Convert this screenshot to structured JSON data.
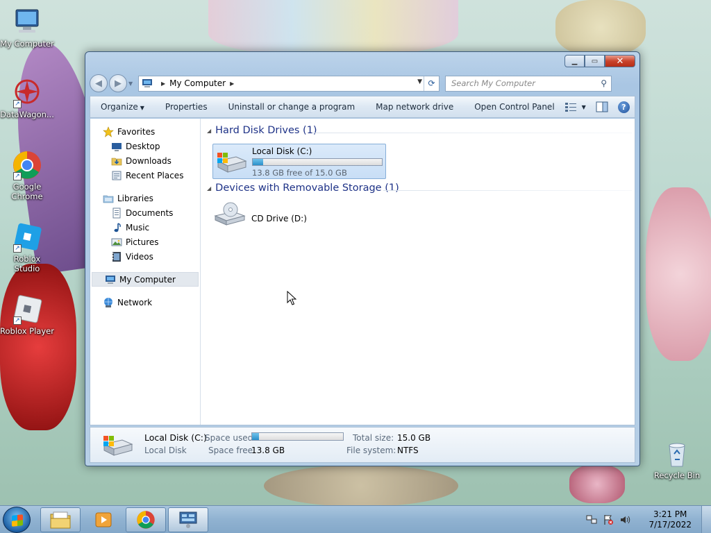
{
  "desktop": {
    "icons": [
      {
        "label": "My Computer"
      },
      {
        "label": "DataWagon..."
      },
      {
        "label": "Google Chrome"
      },
      {
        "label": "Roblox Studio"
      },
      {
        "label": "Roblox Player"
      },
      {
        "label": "Recycle Bin"
      }
    ]
  },
  "window": {
    "address": {
      "crumb": "My Computer"
    },
    "search": {
      "placeholder": "Search My Computer"
    },
    "toolbar": {
      "organize": "Organize",
      "properties": "Properties",
      "uninstall": "Uninstall or change a program",
      "map_drive": "Map network drive",
      "control_panel": "Open Control Panel"
    },
    "nav": {
      "favorites": "Favorites",
      "desktop": "Desktop",
      "downloads": "Downloads",
      "recent": "Recent Places",
      "libraries": "Libraries",
      "documents": "Documents",
      "music": "Music",
      "pictures": "Pictures",
      "videos": "Videos",
      "my_computer": "My Computer",
      "network": "Network"
    },
    "sections": {
      "hdd": "Hard Disk Drives (1)",
      "removable": "Devices with Removable Storage (1)"
    },
    "drives": {
      "c_name": "Local Disk (C:)",
      "c_free": "13.8 GB free of 15.0 GB",
      "c_used_fraction": 0.08,
      "d_name": "CD Drive (D:)"
    },
    "details": {
      "name": "Local Disk (C:)",
      "type": "Local Disk",
      "space_used_label": "Space used:",
      "space_free_label": "Space free:",
      "space_free": "13.8 GB",
      "total_label": "Total size:",
      "total": "15.0 GB",
      "fs_label": "File system:",
      "fs": "NTFS"
    }
  },
  "taskbar": {
    "clock_time": "3:21 PM",
    "clock_date": "7/17/2022"
  },
  "colors": {
    "section_heading": "#1e3287",
    "selection": "#cfe3f8",
    "progress": "#2a8fc9"
  }
}
